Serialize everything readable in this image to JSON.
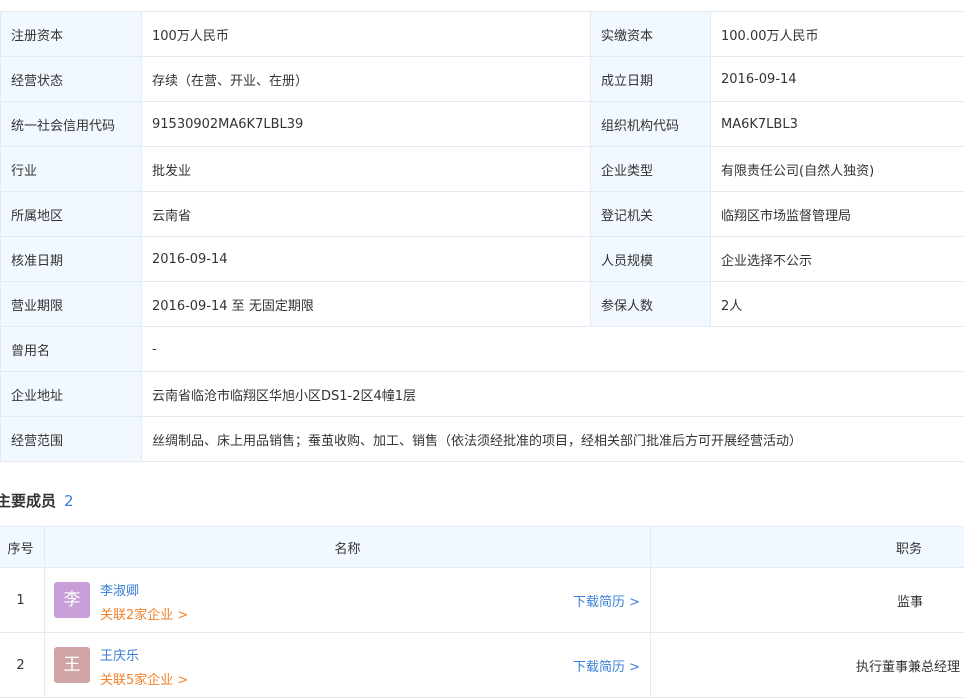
{
  "info": {
    "rows": [
      {
        "k1": "注册资本",
        "v1": "100万人民币",
        "k2": "实缴资本",
        "v2": "100.00万人民币"
      },
      {
        "k1": "经营状态",
        "v1": "存续（在营、开业、在册）",
        "k2": "成立日期",
        "v2": "2016-09-14"
      },
      {
        "k1": "统一社会信用代码",
        "v1": "91530902MA6K7LBL39",
        "k2": "组织机构代码",
        "v2": "MA6K7LBL3"
      },
      {
        "k1": "行业",
        "v1": "批发业",
        "k2": "企业类型",
        "v2": "有限责任公司(自然人独资)"
      },
      {
        "k1": "所属地区",
        "v1": "云南省",
        "k2": "登记机关",
        "v2": "临翔区市场监督管理局"
      },
      {
        "k1": "核准日期",
        "v1": "2016-09-14",
        "k2": "人员规模",
        "v2": "企业选择不公示"
      },
      {
        "k1": "营业期限",
        "v1": "2016-09-14 至 无固定期限",
        "k2": "参保人数",
        "v2": "2人"
      }
    ],
    "wide_rows": [
      {
        "k": "曾用名",
        "v": "-"
      },
      {
        "k": "企业地址",
        "v": "云南省临沧市临翔区华旭小区DS1-2区4幢1层"
      },
      {
        "k": "经营范围",
        "v": "丝绸制品、床上用品销售；蚕茧收购、加工、销售（依法须经批准的项目，经相关部门批准后方可开展经营活动）"
      }
    ]
  },
  "members": {
    "title": "主要成员",
    "count": "2",
    "headers": {
      "index": "序号",
      "name": "名称",
      "role": "职务"
    },
    "rows": [
      {
        "index": "1",
        "avatar": "李",
        "avatar_color": "#c79ed6",
        "name": "李淑卿",
        "related": "关联2家企业 >",
        "download": "下载简历 >",
        "role": "监事"
      },
      {
        "index": "2",
        "avatar": "王",
        "avatar_color": "#d1a5a5",
        "name": "王庆乐",
        "related": "关联5家企业 >",
        "download": "下载简历 >",
        "role": "执行董事兼总经理"
      }
    ]
  }
}
